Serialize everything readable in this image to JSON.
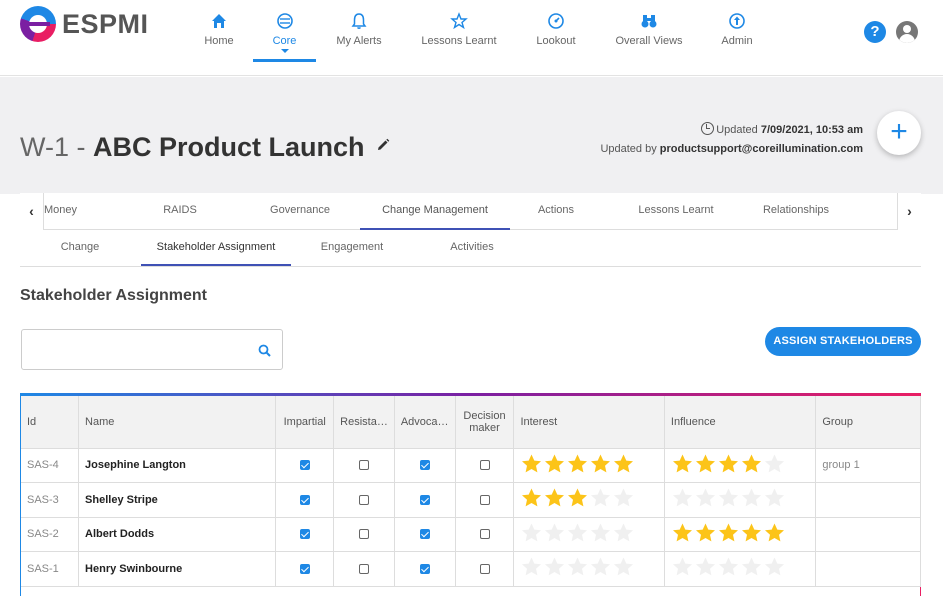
{
  "app": {
    "logo_text": "ESPMI"
  },
  "nav": {
    "items": [
      {
        "label": "Home",
        "icon": "home-icon"
      },
      {
        "label": "Core",
        "icon": "core-icon"
      },
      {
        "label": "My Alerts",
        "icon": "bell-icon"
      },
      {
        "label": "Lessons Learnt",
        "icon": "lessons-icon"
      },
      {
        "label": "Lookout",
        "icon": "lookout-icon"
      },
      {
        "label": "Overall Views",
        "icon": "binoculars-icon"
      },
      {
        "label": "Admin",
        "icon": "admin-icon"
      }
    ],
    "active": "Core"
  },
  "header": {
    "code": "W-1 - ",
    "name": "ABC Product Launch",
    "updated_prefix": "Updated ",
    "updated_value": "7/09/2021, 10:53 am",
    "updated_by_prefix": "Updated by ",
    "updated_by_value": "productsupport@coreillumination.com",
    "fab_label": "+"
  },
  "tabs1": [
    "Money",
    "RAIDS",
    "Governance",
    "Change Management",
    "Actions",
    "Lessons Learnt",
    "Relationships"
  ],
  "tabs1_active": "Change Management",
  "tabs2": [
    "Change",
    "Stakeholder Assignment",
    "Engagement",
    "Activities"
  ],
  "tabs2_active": "Stakeholder Assignment",
  "section_title": "Stakeholder Assignment",
  "search": {
    "value": "",
    "placeholder": ""
  },
  "assign_button": "ASSIGN STAKEHOLDERS",
  "table": {
    "headers": {
      "id": "Id",
      "name": "Name",
      "impartial": "Impartial",
      "resistant": "Resista…",
      "advocate": "Advoca…",
      "decision_maker": "Decision maker",
      "interest": "Interest",
      "influence": "Influence",
      "group": "Group"
    },
    "rows": [
      {
        "id": "SAS-4",
        "name": "Josephine Langton",
        "impartial": true,
        "resistant": false,
        "advocate": true,
        "decision_maker": false,
        "interest": 5,
        "influence": 4,
        "group": "group 1"
      },
      {
        "id": "SAS-3",
        "name": "Shelley Stripe",
        "impartial": true,
        "resistant": false,
        "advocate": true,
        "decision_maker": false,
        "interest": 3,
        "influence": 0,
        "group": ""
      },
      {
        "id": "SAS-2",
        "name": "Albert Dodds",
        "impartial": true,
        "resistant": false,
        "advocate": true,
        "decision_maker": false,
        "interest": 0,
        "influence": 5,
        "group": ""
      },
      {
        "id": "SAS-1",
        "name": "Henry Swinbourne",
        "impartial": true,
        "resistant": false,
        "advocate": true,
        "decision_maker": false,
        "interest": 0,
        "influence": 0,
        "group": ""
      }
    ],
    "max_stars": 5
  },
  "colors": {
    "accent": "#1e88e5",
    "star_on": "#fcc419",
    "star_off": "#f0f0f0",
    "tab_active": "#3f51b5"
  }
}
